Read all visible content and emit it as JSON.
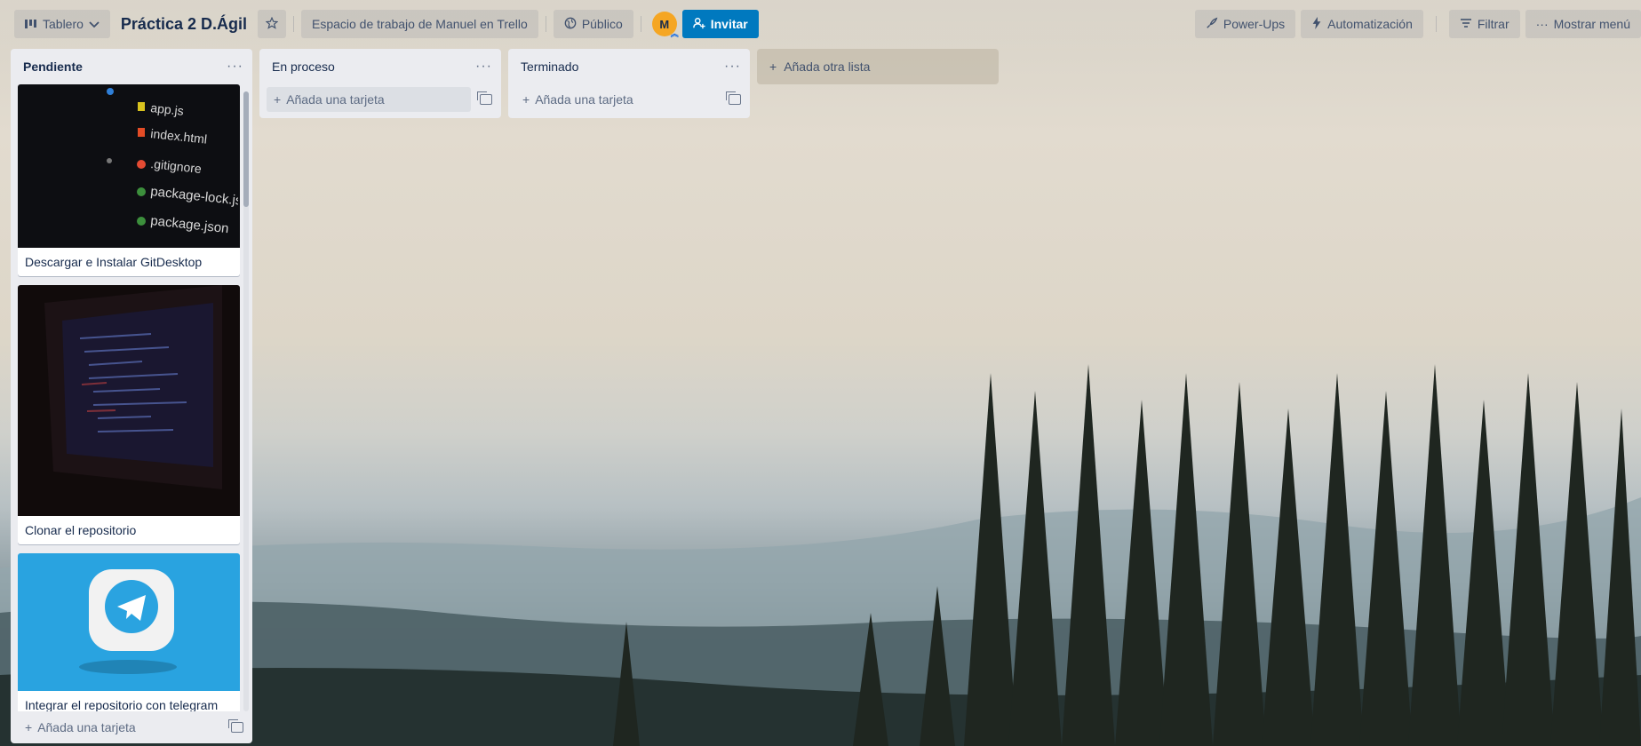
{
  "header": {
    "view_switcher_label": "Tablero",
    "board_title": "Práctica 2 D.Ágil",
    "workspace_label": "Espacio de trabajo de Manuel en Trello",
    "visibility_label": "Público",
    "member_initial": "M",
    "invite_label": "Invitar",
    "power_ups_label": "Power-Ups",
    "automation_label": "Automatización",
    "filter_label": "Filtrar",
    "menu_label": "Mostrar menú"
  },
  "lists": [
    {
      "title": "Pendiente",
      "cards": [
        {
          "title": "Descargar e Instalar GitDesktop",
          "cover": "code-file-tree-photo"
        },
        {
          "title": "Clonar el repositorio",
          "cover": "laptop-code-photo"
        },
        {
          "title": "Integrar el repositorio con telegram",
          "cover": "telegram-logo-photo"
        }
      ],
      "add_card_label": "Añada una tarjeta"
    },
    {
      "title": "En proceso",
      "cards": [],
      "add_card_label": "Añada una tarjeta"
    },
    {
      "title": "Terminado",
      "cards": [],
      "add_card_label": "Añada una tarjeta"
    }
  ],
  "cover_file_names": [
    "app.js",
    "index.html",
    ".gitignore",
    "package-lock.json",
    "package.json"
  ],
  "add_list_label": "Añada otra lista",
  "colors": {
    "invite": "#0079bf",
    "avatar": "#f5a623",
    "list_bg": "#ebecf0",
    "telegram": "#29a3e0"
  }
}
